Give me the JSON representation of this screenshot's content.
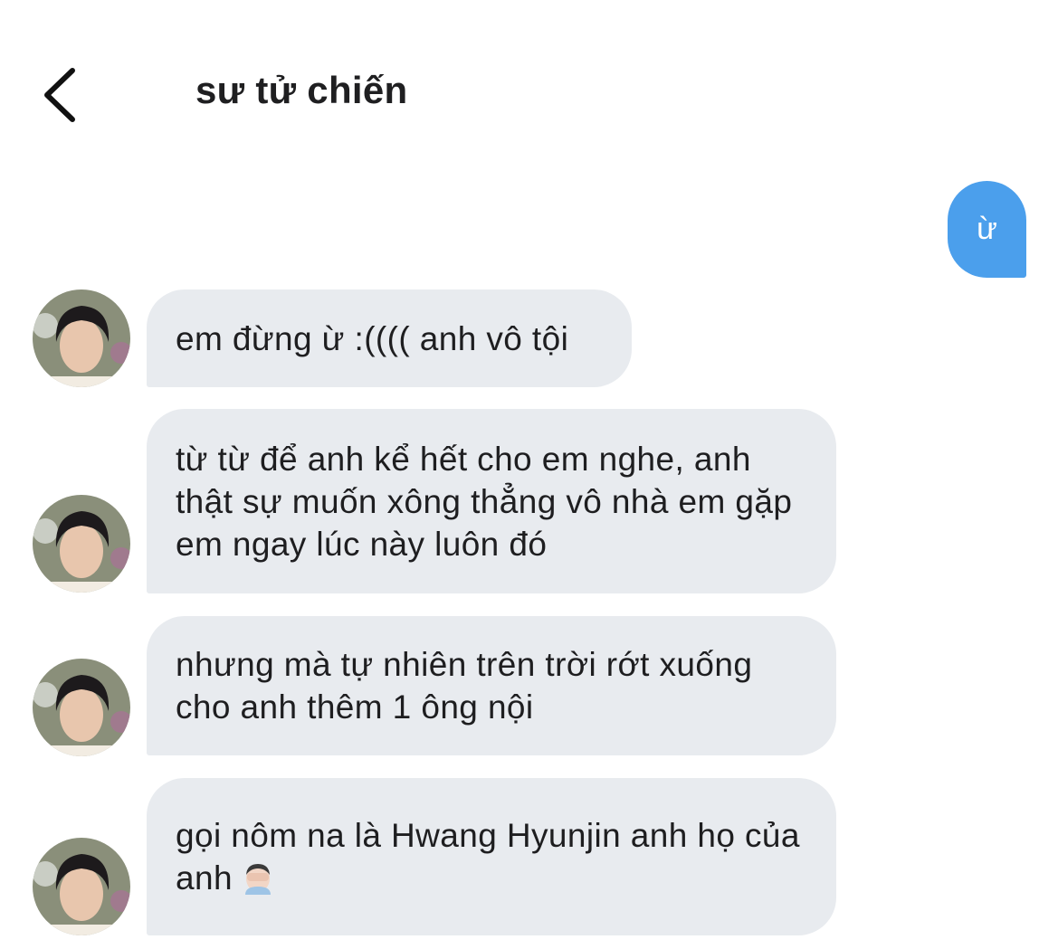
{
  "header": {
    "back_icon": "chevron-left-icon",
    "title": "sư tử chiến"
  },
  "messages": [
    {
      "direction": "outgoing",
      "text": "ừ"
    },
    {
      "direction": "incoming",
      "text": "em đừng ừ :(((( anh vô tội"
    },
    {
      "direction": "incoming",
      "text": "từ từ để anh kể hết cho em nghe, anh thật sự muốn xông thẳng vô nhà em gặp em ngay lúc này luôn đó"
    },
    {
      "direction": "incoming",
      "text": "nhưng mà tự nhiên trên trời rớt xuống cho anh thêm 1 ông nội"
    },
    {
      "direction": "incoming",
      "text": "gọi nôm na là Hwang Hyunjin anh họ của anh",
      "emoji": "face-palm-emoji"
    }
  ],
  "colors": {
    "outgoing_bubble": "#4b9fec",
    "incoming_bubble": "#e8ebef",
    "text": "#1e1e20"
  }
}
